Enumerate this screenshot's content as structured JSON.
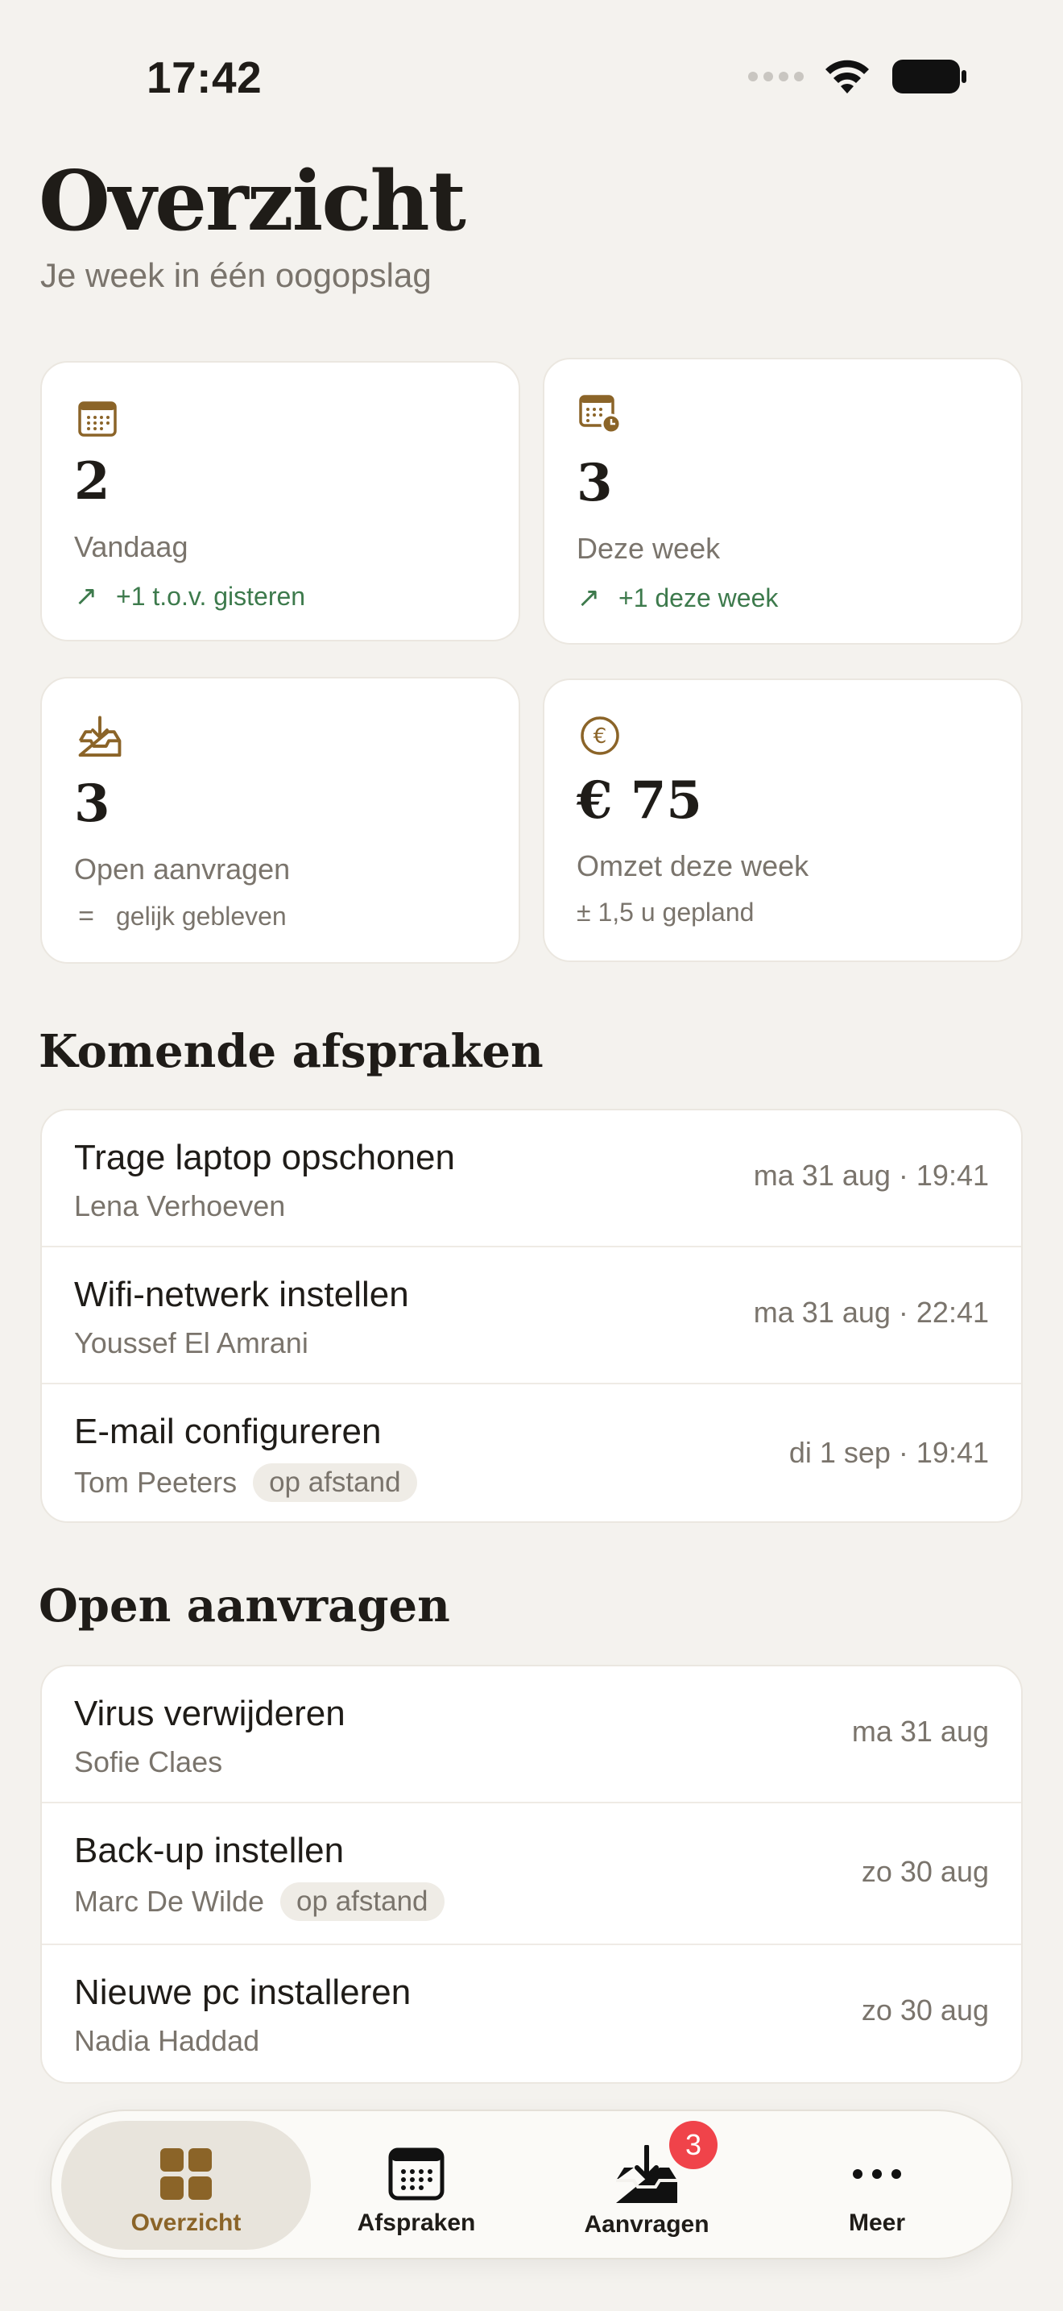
{
  "status_bar": {
    "time": "17:42"
  },
  "header": {
    "title": "Overzicht",
    "subtitle": "Je week in één oogopslag"
  },
  "stats": [
    {
      "icon": "calendar-icon",
      "value": "2",
      "label": "Vandaag",
      "trend_glyph": "↗",
      "trend": "+1 t.o.v. gisteren",
      "trend_type": "up"
    },
    {
      "icon": "calendar-clock-icon",
      "value": "3",
      "label": "Deze week",
      "trend_glyph": "↗",
      "trend": "+1 deze week",
      "trend_type": "up"
    },
    {
      "icon": "inbox-download-icon",
      "value": "3",
      "label": "Open aanvragen",
      "trend_glyph": "=",
      "trend": "gelijk gebleven",
      "trend_type": "flat"
    },
    {
      "icon": "euro-coin-icon",
      "value": "€ 75",
      "label": "Omzet deze week",
      "trend": "± 1,5 u gepland",
      "trend_type": "flat"
    }
  ],
  "upcoming": {
    "title": "Komende afspraken",
    "items": [
      {
        "title": "Trage laptop opschonen",
        "client": "Lena Verhoeven",
        "tag": "",
        "date": "ma 31 aug · 19:41"
      },
      {
        "title": "Wifi-netwerk instellen",
        "client": "Youssef El Amrani",
        "tag": "",
        "date": "ma 31 aug · 22:41"
      },
      {
        "title": "E-mail configureren",
        "client": "Tom Peeters",
        "tag": "op afstand",
        "date": "di 1 sep · 19:41"
      }
    ]
  },
  "requests": {
    "title": "Open aanvragen",
    "items": [
      {
        "title": "Virus verwijderen",
        "client": "Sofie Claes",
        "tag": "",
        "date": "ma 31 aug"
      },
      {
        "title": "Back-up instellen",
        "client": "Marc De Wilde",
        "tag": "op afstand",
        "date": "zo 30 aug"
      },
      {
        "title": "Nieuwe pc installeren",
        "client": "Nadia Haddad",
        "tag": "",
        "date": "zo 30 aug"
      }
    ]
  },
  "tab_bar": {
    "tabs": [
      {
        "label": "Overzicht",
        "icon": "grid-icon",
        "active": true
      },
      {
        "label": "Afspraken",
        "icon": "calendar-icon",
        "active": false
      },
      {
        "label": "Aanvragen",
        "icon": "inbox-download-icon",
        "active": false,
        "badge": "3"
      },
      {
        "label": "Meer",
        "icon": "more-dots-icon",
        "active": false
      }
    ]
  },
  "colors": {
    "accent": "#8b6428",
    "positive": "#3d7a4c",
    "badge": "#f0434a",
    "background": "#f4f2ee"
  }
}
